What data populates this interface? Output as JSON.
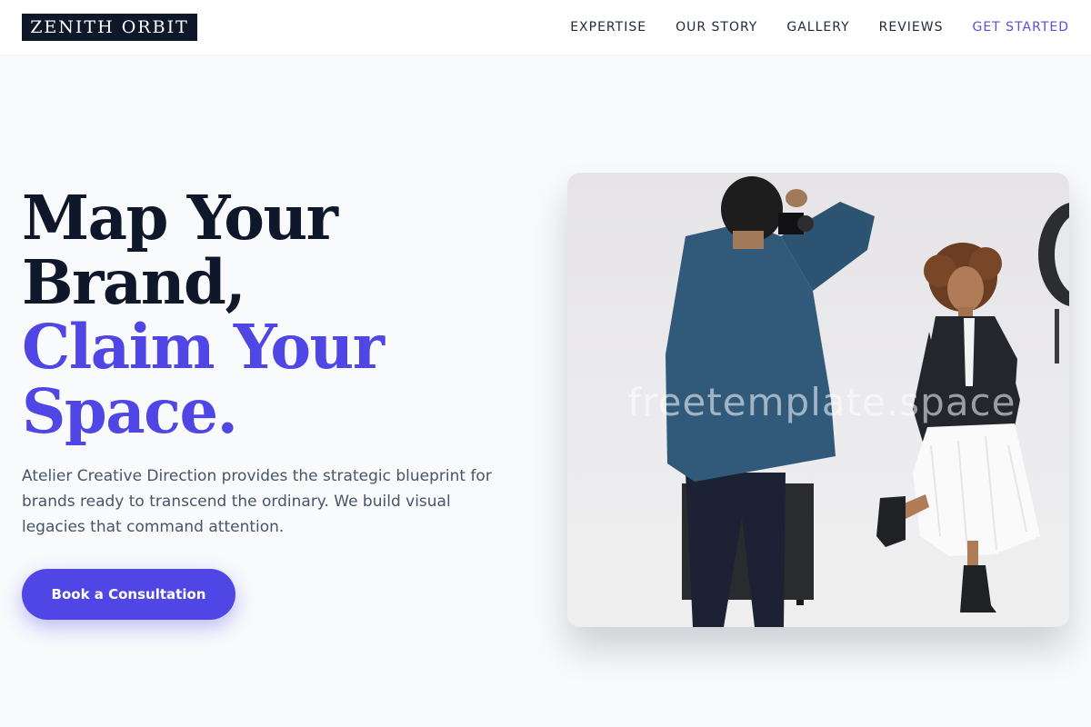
{
  "brand": {
    "logo_text": "ZENITH ORBIT"
  },
  "nav": {
    "items": [
      {
        "label": "EXPERTISE"
      },
      {
        "label": "OUR STORY"
      },
      {
        "label": "GALLERY"
      },
      {
        "label": "REVIEWS"
      },
      {
        "label": "GET STARTED"
      }
    ]
  },
  "hero": {
    "headline_lines": [
      "Map Your",
      "Brand,",
      "Claim Your",
      "Space."
    ],
    "lead": "Atelier Creative Direction provides the strategic blueprint for brands ready to transcend the ordinary. We build visual legacies that command attention.",
    "cta_label": "Book a Consultation",
    "watermark": "freetemplate.space"
  },
  "colors": {
    "accent": "#4f46e5",
    "dark": "#0f172a",
    "background": "#f8fafc",
    "body_text": "#475569"
  }
}
